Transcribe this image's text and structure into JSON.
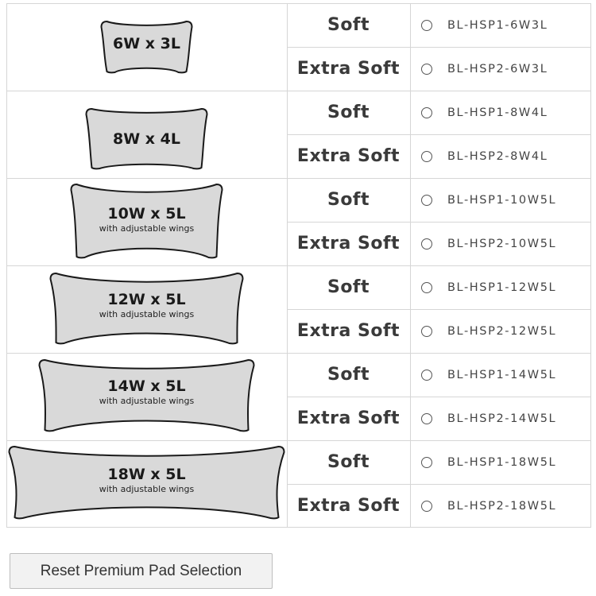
{
  "pad_rows": [
    {
      "size": "6W x 3L",
      "note": "",
      "options": [
        {
          "firmness": "Soft",
          "sku": "BL-HSP1-6W3L",
          "selected": false
        },
        {
          "firmness": "Extra Soft",
          "sku": "BL-HSP2-6W3L",
          "selected": false
        }
      ]
    },
    {
      "size": "8W x 4L",
      "note": "",
      "options": [
        {
          "firmness": "Soft",
          "sku": "BL-HSP1-8W4L",
          "selected": false
        },
        {
          "firmness": "Extra Soft",
          "sku": "BL-HSP2-8W4L",
          "selected": false
        }
      ]
    },
    {
      "size": "10W x 5L",
      "note": "with adjustable wings",
      "options": [
        {
          "firmness": "Soft",
          "sku": "BL-HSP1-10W5L",
          "selected": false
        },
        {
          "firmness": "Extra Soft",
          "sku": "BL-HSP2-10W5L",
          "selected": false
        }
      ]
    },
    {
      "size": "12W x 5L",
      "note": "with adjustable wings",
      "options": [
        {
          "firmness": "Soft",
          "sku": "BL-HSP1-12W5L",
          "selected": false
        },
        {
          "firmness": "Extra Soft",
          "sku": "BL-HSP2-12W5L",
          "selected": false
        }
      ]
    },
    {
      "size": "14W x 5L",
      "note": "with adjustable wings",
      "options": [
        {
          "firmness": "Soft",
          "sku": "BL-HSP1-14W5L",
          "selected": false
        },
        {
          "firmness": "Extra Soft",
          "sku": "BL-HSP2-14W5L",
          "selected": false
        }
      ]
    },
    {
      "size": "18W x 5L",
      "note": "with adjustable wings",
      "options": [
        {
          "firmness": "Soft",
          "sku": "BL-HSP1-18W5L",
          "selected": false
        },
        {
          "firmness": "Extra Soft",
          "sku": "BL-HSP2-18W5L",
          "selected": false
        }
      ]
    }
  ],
  "reset_button_label": "Reset Premium Pad Selection",
  "icons": {
    "pad_shape": "pad-shape-icon",
    "radio": "radio-button-icon"
  },
  "colors": {
    "pad_fill": "#d9d9d9",
    "pad_outline": "#1a1a1a",
    "grid": "#d6d6d6",
    "button_bg": "#f2f2f2"
  }
}
